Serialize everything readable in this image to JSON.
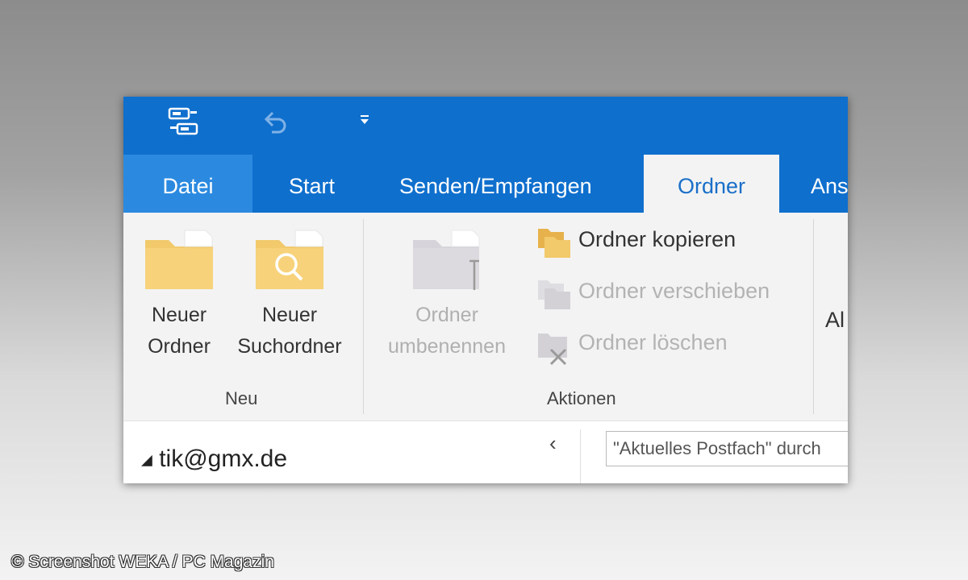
{
  "tabs": [
    {
      "label": "Datei"
    },
    {
      "label": "Start"
    },
    {
      "label": "Senden/Empfangen"
    },
    {
      "label": "Ordner"
    },
    {
      "label": "Ans"
    }
  ],
  "ribbon": {
    "neu": {
      "label": "Neu",
      "new_folder": {
        "line1": "Neuer",
        "line2": "Ordner"
      },
      "new_search_folder": {
        "line1": "Neuer",
        "line2": "Suchordner"
      }
    },
    "aktionen": {
      "label": "Aktionen",
      "rename": {
        "line1": "Ordner",
        "line2": "umbenennen"
      },
      "copy": "Ordner kopieren",
      "move": "Ordner verschieben",
      "delete": "Ordner löschen"
    },
    "next_group_partial": "Al"
  },
  "folder_pane": {
    "mailbox": "tik@gmx.de",
    "search_placeholder": "\"Aktuelles Postfach\" durch"
  },
  "credit": "© Screenshot WEKA / PC Magazin",
  "colors": {
    "ribbon_blue": "#0f6fcd",
    "folder_yellow": "#f2c96b",
    "disabled_gray": "#d6d4da"
  }
}
